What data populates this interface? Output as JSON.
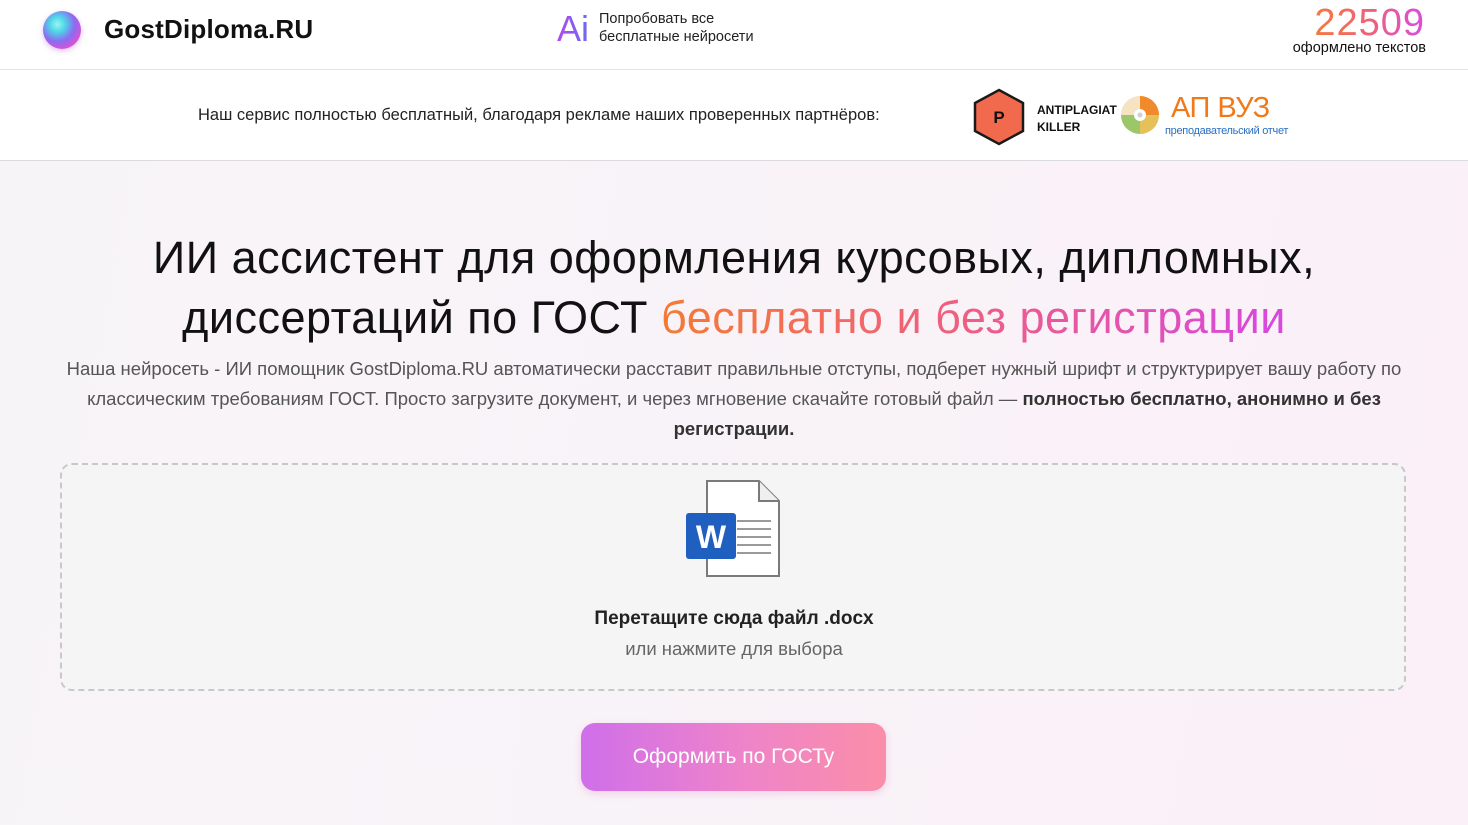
{
  "header": {
    "brand": "GostDiploma.RU",
    "ai_glyph": "Ai",
    "ai_link_line1": "Попробовать все",
    "ai_link_line2": "бесплатные нейросети",
    "counter_value": "22509",
    "counter_caption": "оформлено текстов"
  },
  "partners": {
    "text": "Наш сервис полностью бесплатный, благодаря рекламе наших проверенных партнёров:",
    "antiplagiat_badge": "P",
    "antiplagiat_line1": "ANTIPLAGIAT",
    "antiplagiat_line2": "KILLER",
    "apvuz_title": "АП ВУЗ",
    "apvuz_subtitle": "преподавательский отчет"
  },
  "hero": {
    "title_line1": "ИИ ассистент для оформления курсовых, дипломных,",
    "title_line2_plain": "диссертаций по ГОСТ ",
    "title_line2_highlight": "бесплатно и без регистрации",
    "description": "Наша нейросеть - ИИ помощник GostDiploma.RU автоматически расставит правильные отступы, подберет нужный шрифт и структурирует вашу работу по классическим требованиям ГОСТ. Просто загрузите документ, и через мгновение скачайте готовый файл — ",
    "description_bold": "полностью бесплатно, анонимно и без регистрации."
  },
  "dropzone": {
    "icon_letter": "W",
    "title": "Перетащите сюда файл .docx",
    "subtitle": "или нажмите для выбора"
  },
  "submit_label": "Оформить по ГОСТу",
  "colors": {
    "accent_orange": "#f47b33",
    "accent_pink": "#f0607c",
    "accent_purple": "#d648e0",
    "word_blue": "#1f5fbf"
  }
}
